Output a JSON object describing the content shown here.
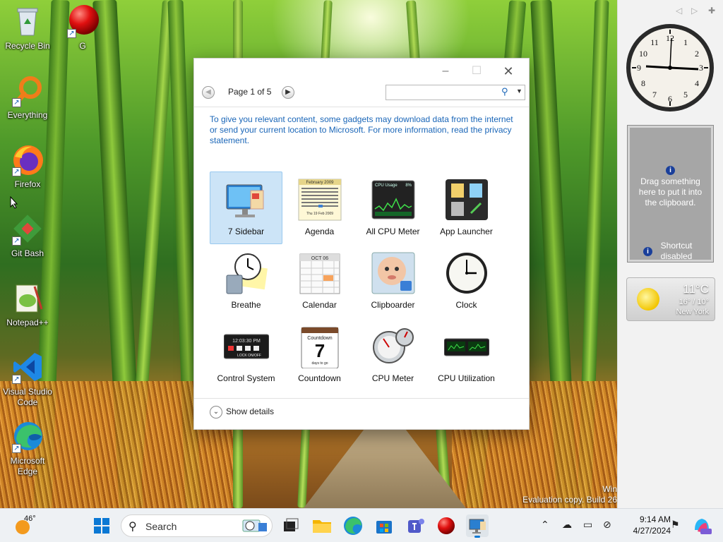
{
  "desktop": {
    "icons": [
      {
        "label": "Recycle Bin"
      },
      {
        "label": "G"
      },
      {
        "label": "Everything"
      },
      {
        "label": "Firefox"
      },
      {
        "label": "Git Bash"
      },
      {
        "label": "Notepad++"
      },
      {
        "label": "Visual Studio Code"
      },
      {
        "label": "Microsoft Edge"
      }
    ],
    "watermark": {
      "line1": "Win",
      "line2": "Evaluation copy. Build 26"
    }
  },
  "gallery": {
    "page_label": "Page 1 of 5",
    "search_placeholder": "",
    "notice": "To give you relevant content, some gadgets may download data from the internet or send your current location to Microsoft. For more information, read the privacy statement.",
    "gadgets": [
      {
        "label": "7 Sidebar",
        "selected": true
      },
      {
        "label": "Agenda"
      },
      {
        "label": "All CPU Meter"
      },
      {
        "label": "App Launcher"
      },
      {
        "label": "Breathe"
      },
      {
        "label": "Calendar"
      },
      {
        "label": "Clipboarder"
      },
      {
        "label": "Clock"
      },
      {
        "label": "Control System"
      },
      {
        "label": "Countdown"
      },
      {
        "label": "CPU Meter"
      },
      {
        "label": "CPU Utilization"
      }
    ],
    "thumb_text": {
      "agenda_header": "February 2009",
      "agenda_footer": "Thu 19 Feb 2009",
      "cpu_usage_title": "CPU Usage",
      "cpu_usage_pct": "8%",
      "calendar_month": "OCT 06",
      "control_time": "12:03:30 PM",
      "control_lock": "LOCK ON/OFF",
      "countdown_title": "Countdown",
      "countdown_days": "7",
      "countdown_sub": "days to go"
    },
    "show_details": "Show details"
  },
  "sidebar": {
    "clipboard": {
      "message": "Drag something here to put it into the clipboard.",
      "shortcut": "Shortcut disabled"
    },
    "weather": {
      "temp": "11°C",
      "range": "16° / 10°",
      "city": "New York"
    }
  },
  "taskbar": {
    "weather_temp": "46°",
    "search_label": "Search",
    "time": "9:14 AM",
    "date": "4/27/2024"
  },
  "colors": {
    "accent": "#1a66b8",
    "selection": "#cce4f7"
  }
}
